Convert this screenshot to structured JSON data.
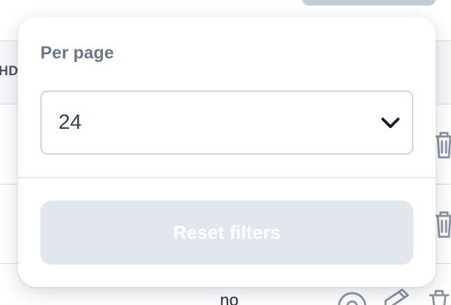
{
  "background": {
    "header_label": "HDA",
    "row_cell_text": "no"
  },
  "filters_panel": {
    "per_page_label": "Per page",
    "per_page_value": "24",
    "reset_label": "Reset filters"
  },
  "icons": {
    "select_arrow": "chevron-down-icon",
    "row_actions": [
      "eye-icon",
      "pencil-icon",
      "trash-icon"
    ]
  },
  "colors": {
    "label": "#6b7687",
    "select_border": "#cfd5dd",
    "reset_button_bg": "#e2e7ee",
    "reset_button_text": "#ffffff",
    "header_bg": "#f6f7f9"
  }
}
